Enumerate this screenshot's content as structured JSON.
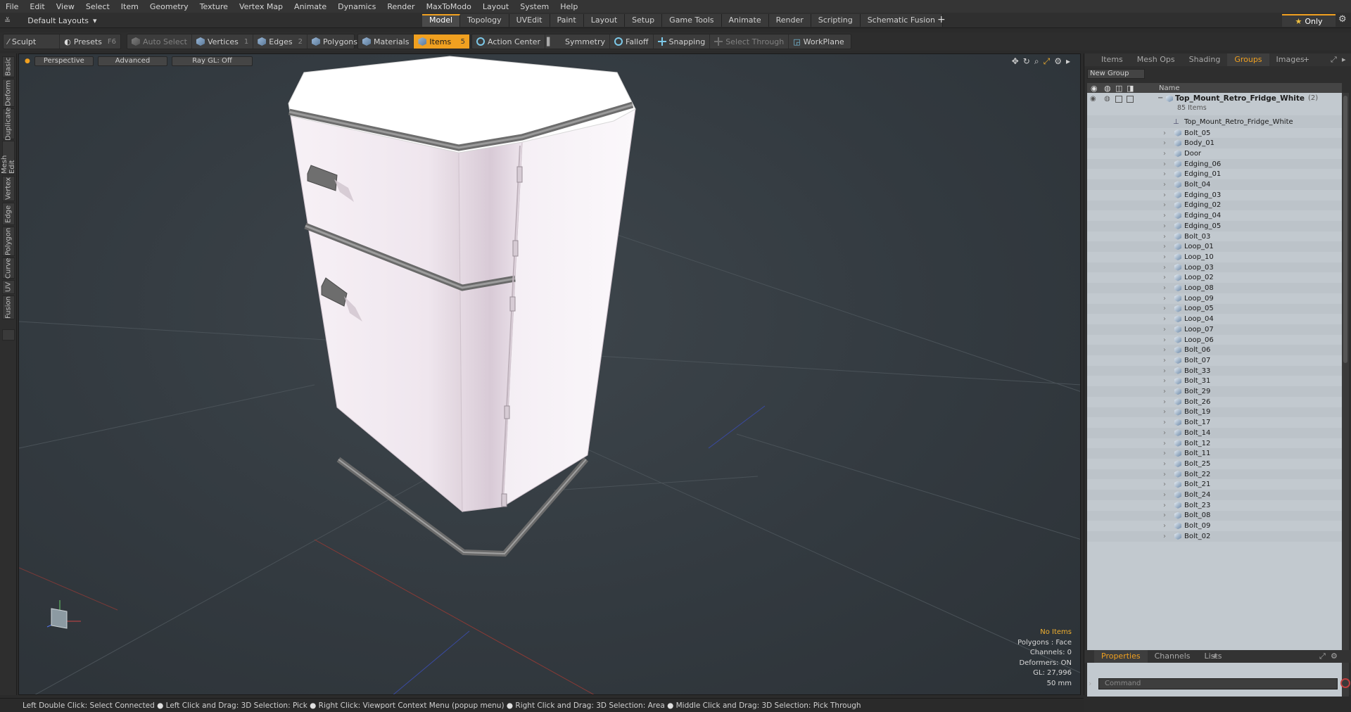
{
  "menu": [
    "File",
    "Edit",
    "View",
    "Select",
    "Item",
    "Geometry",
    "Texture",
    "Vertex Map",
    "Animate",
    "Dynamics",
    "Render",
    "MaxToModo",
    "Layout",
    "System",
    "Help"
  ],
  "layout_selector": "Default Layouts",
  "layout_tabs": [
    {
      "label": "Model",
      "active": true
    },
    {
      "label": "Topology"
    },
    {
      "label": "UVEdit"
    },
    {
      "label": "Paint"
    },
    {
      "label": "Layout"
    },
    {
      "label": "Setup"
    },
    {
      "label": "Game Tools"
    },
    {
      "label": "Animate"
    },
    {
      "label": "Render"
    },
    {
      "label": "Scripting"
    },
    {
      "label": "Schematic Fusion"
    }
  ],
  "only_label": "Only",
  "toolbar": {
    "sculpt": "Sculpt",
    "presets": "Presets",
    "presets_key": "F6",
    "auto_select": "Auto Select",
    "vertices": "Vertices",
    "vertices_key": "1",
    "edges": "Edges",
    "edges_key": "2",
    "polygons": "Polygons",
    "materials": "Materials",
    "items": "Items",
    "items_key": "5",
    "action_center": "Action Center",
    "symmetry": "Symmetry",
    "falloff": "Falloff",
    "snapping": "Snapping",
    "select_through": "Select Through",
    "workplane": "WorkPlane"
  },
  "left_tabs": [
    "Basic",
    "Deform",
    "Duplicate",
    "Mesh Edit",
    "Vertex",
    "Edge",
    "Polygon",
    "Curve",
    "UV",
    "Fusion"
  ],
  "viewport": {
    "perspective": "Perspective",
    "advanced": "Advanced",
    "raygl": "Ray GL: Off",
    "info": {
      "no_items": "No Items",
      "polygons": "Polygons : Face",
      "channels": "Channels: 0",
      "deformers": "Deformers: ON",
      "gl": "GL: 27,996",
      "scale": "50 mm"
    }
  },
  "right_panel": {
    "tabs": [
      {
        "label": "Items"
      },
      {
        "label": "Mesh Ops"
      },
      {
        "label": "Shading"
      },
      {
        "label": "Groups",
        "active": true
      },
      {
        "label": "Images"
      }
    ],
    "new_group": "New Group",
    "col_name": "Name",
    "root_name": "Top_Mount_Retro_Fridge_White",
    "root_count": "(2)",
    "root_items": "85 Items",
    "locator": "Top_Mount_Retro_Fridge_White",
    "items": [
      "Bolt_05",
      "Body_01",
      "Door",
      "Edging_06",
      "Edging_01",
      "Bolt_04",
      "Edging_03",
      "Edging_02",
      "Edging_04",
      "Edging_05",
      "Bolt_03",
      "Loop_01",
      "Loop_10",
      "Loop_03",
      "Loop_02",
      "Loop_08",
      "Loop_09",
      "Loop_05",
      "Loop_04",
      "Loop_07",
      "Loop_06",
      "Bolt_06",
      "Bolt_07",
      "Bolt_33",
      "Bolt_31",
      "Bolt_29",
      "Bolt_26",
      "Bolt_19",
      "Bolt_17",
      "Bolt_14",
      "Bolt_12",
      "Bolt_11",
      "Bolt_25",
      "Bolt_22",
      "Bolt_21",
      "Bolt_24",
      "Bolt_23",
      "Bolt_08",
      "Bolt_09",
      "Bolt_02"
    ],
    "bottom_tabs": [
      {
        "label": "Properties",
        "active": true
      },
      {
        "label": "Channels"
      },
      {
        "label": "Lists"
      }
    ],
    "command_placeholder": "Command"
  },
  "status_bar": [
    "Left Double Click: Select Connected",
    "Left Click and Drag: 3D Selection: Pick",
    "Right Click: Viewport Context Menu (popup menu)",
    "Right Click and Drag: 3D Selection: Area",
    "Middle Click and Drag: 3D Selection: Pick Through"
  ],
  "colors": {
    "accent": "#f0a020",
    "viewport_bg": "#353c42",
    "list_bg": "#c2c9cf"
  }
}
